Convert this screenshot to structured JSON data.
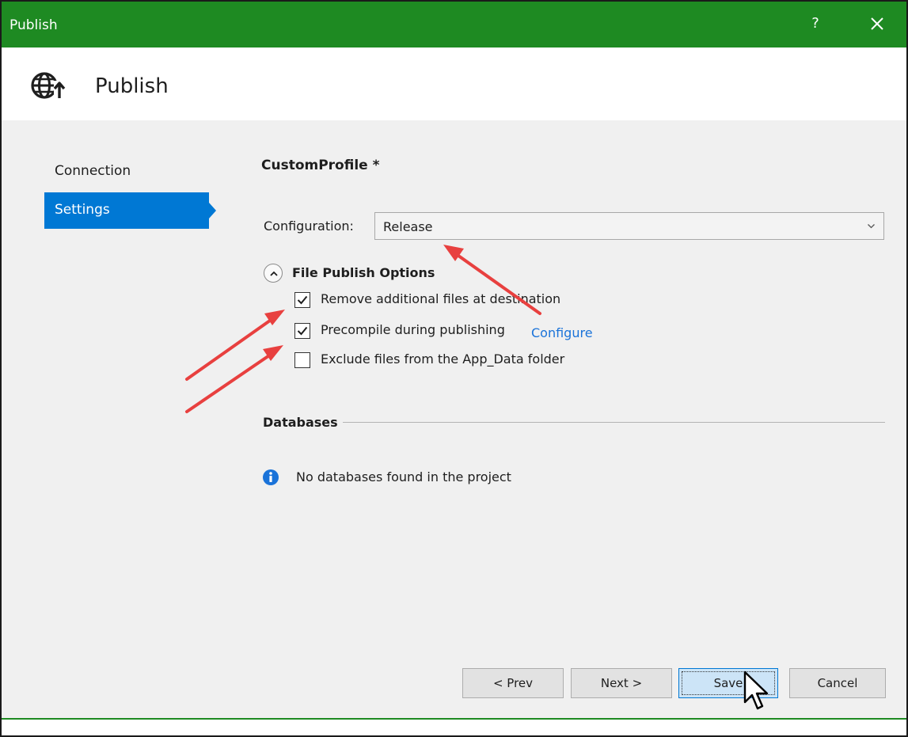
{
  "window": {
    "title": "Publish",
    "help_label": "?",
    "title_bar_color": "#1e8a22"
  },
  "header": {
    "title": "Publish",
    "icon": "globe-publish-icon"
  },
  "sidebar": {
    "items": [
      {
        "label": "Connection",
        "selected": false
      },
      {
        "label": "Settings",
        "selected": true
      }
    ],
    "accent_color": "#0078d4"
  },
  "main": {
    "profile_name": "CustomProfile *",
    "configuration": {
      "label": "Configuration:",
      "value": "Release"
    },
    "file_publish_options": {
      "title": "File Publish Options",
      "expanded": true,
      "options": [
        {
          "label": "Remove additional files at destination",
          "checked": true
        },
        {
          "label": "Precompile during publishing",
          "checked": true
        },
        {
          "label": "Exclude files from the App_Data folder",
          "checked": false
        }
      ],
      "configure_link": "Configure"
    },
    "databases": {
      "title": "Databases",
      "message": "No databases found in the project"
    }
  },
  "footer": {
    "prev_label": "< Prev",
    "next_label": "Next >",
    "save_label": "Save",
    "cancel_label": "Cancel"
  },
  "annotations": {
    "arrow_color": "#e8403f"
  }
}
